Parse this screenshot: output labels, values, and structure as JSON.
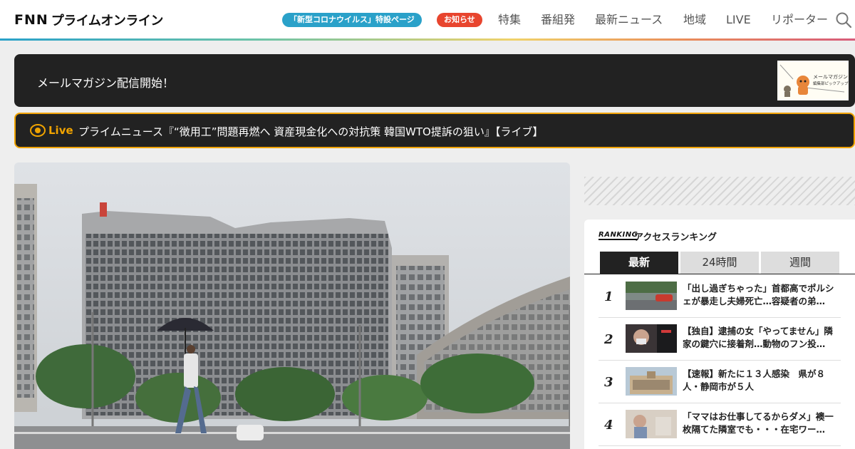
{
  "header": {
    "logo_fnn": "FNN",
    "logo_text": "プライムオンライン",
    "pill_corona": "「新型コロナウイルス」特設ページ",
    "pill_notice": "お知らせ",
    "nav": [
      "特集",
      "番組発",
      "最新ニュース",
      "地域",
      "LIVE",
      "リポーター"
    ],
    "search_icon": "search-icon"
  },
  "banner": {
    "text": "メールマガジン配信開始！",
    "thumb_caption_1": "メールマガジン",
    "thumb_caption_2": "編集部ピックアップ"
  },
  "live": {
    "label": "Live",
    "title": "プライムニュース『“徴用工”問題再燃へ 資産現金化への対抗策 韓国WTO提訴の狙い』【ライブ】"
  },
  "ranking": {
    "logo": "RANKING",
    "title": "アクセスランキング",
    "tabs": [
      "最新",
      "24時間",
      "週間"
    ],
    "active_tab": 0,
    "items": [
      {
        "rank": "1",
        "text": "「出し過ぎちゃった」首都高でポルシェが暴走し夫婦死亡…容疑者の弟…"
      },
      {
        "rank": "2",
        "text": "【独自】逮捕の女「やってません」隣家の鍵穴に接着剤…動物のフン投…"
      },
      {
        "rank": "3",
        "text": "【速報】新たに１３人感染　県が８人・静岡市が５人"
      },
      {
        "rank": "4",
        "text": "「ママはお仕事してるからダメ」襖一枚隔てた隣室でも・・・在宅ワー…"
      }
    ]
  },
  "colors": {
    "accent_blue": "#2aa1c9",
    "notice_red": "#e8452e",
    "live_orange": "#f0a300",
    "dark_bar": "#222222"
  }
}
